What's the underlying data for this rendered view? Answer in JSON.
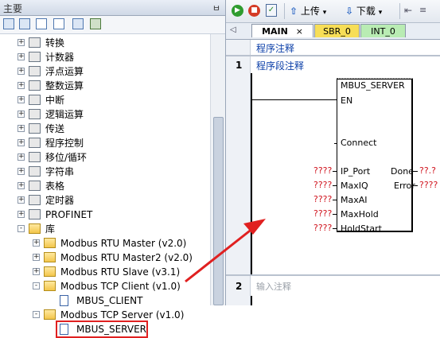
{
  "left_panel": {
    "title": "主要",
    "pin": "ㅂ",
    "tree": [
      {
        "label": "转换",
        "expander": "+"
      },
      {
        "label": "计数器",
        "expander": "+"
      },
      {
        "label": "浮点运算",
        "expander": "+"
      },
      {
        "label": "整数运算",
        "expander": "+"
      },
      {
        "label": "中断",
        "expander": "+"
      },
      {
        "label": "逻辑运算",
        "expander": "+"
      },
      {
        "label": "传送",
        "expander": "+"
      },
      {
        "label": "程序控制",
        "expander": "+"
      },
      {
        "label": "移位/循环",
        "expander": "+"
      },
      {
        "label": "字符串",
        "expander": "+"
      },
      {
        "label": "表格",
        "expander": "+"
      },
      {
        "label": "定时器",
        "expander": "+"
      },
      {
        "label": "PROFINET",
        "expander": "+"
      },
      {
        "label": "库",
        "expander": "-"
      },
      {
        "label": "Modbus RTU Master (v2.0)",
        "expander": "+"
      },
      {
        "label": "Modbus RTU Master2 (v2.0)",
        "expander": "+"
      },
      {
        "label": "Modbus RTU Slave (v3.1)",
        "expander": "+"
      },
      {
        "label": "Modbus TCP Client (v1.0)",
        "expander": "-"
      },
      {
        "label": "MBUS_CLIENT",
        "expander": ""
      },
      {
        "label": "Modbus TCP Server (v1.0)",
        "expander": "-"
      },
      {
        "label": "MBUS_SERVER",
        "expander": ""
      }
    ]
  },
  "toolbar": {
    "upload_label": "上传",
    "download_label": "下载",
    "upload_arrow": "▾",
    "download_arrow": "▾"
  },
  "tabs": {
    "nav_left": "◁",
    "items": [
      {
        "label": "MAIN",
        "close": "×"
      },
      {
        "label": "SBR_0"
      },
      {
        "label": "INT_0"
      }
    ]
  },
  "editor": {
    "program_comment": "程序注释",
    "network1_number": "1",
    "network1_comment": "程序段注释",
    "network2_number": "2",
    "network2_comment": "输入注释",
    "block": {
      "name": "MBUS_SERVER",
      "en": "EN",
      "connect": "Connect",
      "inputs": [
        "IP_Port",
        "MaxIQ",
        "MaxAI",
        "MaxHold",
        "HoldStart"
      ],
      "outputs": [
        "Done",
        "Error"
      ],
      "input_values": [
        "????",
        "????",
        "????",
        "????",
        "????"
      ],
      "output_values": [
        "??.?",
        "????"
      ]
    }
  },
  "colors": {
    "annotation": "#e02020",
    "comment_blue": "#0b3fa8",
    "unassigned": "#d0131d"
  }
}
